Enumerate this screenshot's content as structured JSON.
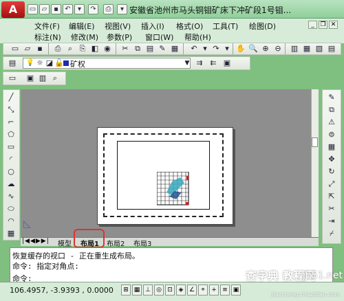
{
  "title": {
    "window_title": "安徽省池州市马头铜钼矿床下冲矿段1号钼..."
  },
  "menu": {
    "row1": [
      "文件(F)",
      "编辑(E)",
      "视图(V)",
      "插入(I)",
      "格式(O)",
      "工具(T)",
      "绘图(D)"
    ],
    "row2": [
      "标注(N)",
      "修改(M)",
      "参数(P)",
      "窗口(W)",
      "帮助(H)"
    ]
  },
  "layer": {
    "current": "矿权"
  },
  "tabs": [
    "模型",
    "布局1",
    "布局2",
    "布局3"
  ],
  "command": {
    "line1": "恢复缓存的视口 - 正在重生成布局。",
    "line2": "命令: 指定对角点:",
    "line3": "命令:"
  },
  "status": {
    "coords": "106.4957, -3.9393 , 0.0000"
  },
  "watermark": {
    "text": "查字典 教程网",
    "url": "jiaocheng.chazidian.com",
    "site": "jb51.net"
  }
}
